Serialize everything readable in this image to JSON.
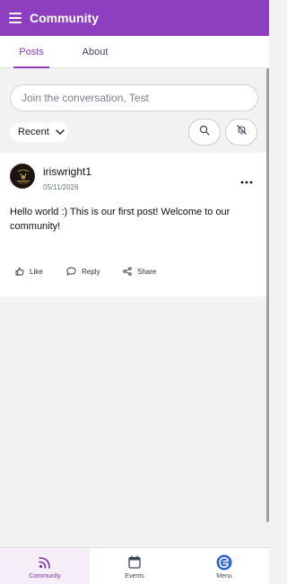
{
  "header": {
    "title": "Community"
  },
  "tabs": [
    {
      "label": "Posts",
      "active": true
    },
    {
      "label": "About",
      "active": false
    }
  ],
  "compose": {
    "placeholder": "Join the conversation, Test"
  },
  "sort": {
    "selected": "Recent"
  },
  "post": {
    "author": "iriswright1",
    "date": "05/11/2026",
    "body": "Hello world :) This is our first post! Welcome to our community!",
    "actions": {
      "like": "Like",
      "reply": "Reply",
      "share": "Share"
    }
  },
  "bottom_nav": [
    {
      "label": "Community",
      "icon": "rss-icon",
      "active": true
    },
    {
      "label": "Events",
      "icon": "calendar-icon",
      "active": false
    },
    {
      "label": "Menu",
      "icon": "menu-logo-icon",
      "active": false
    }
  ],
  "colors": {
    "brand": "#8d3fbf",
    "nav_active_bg": "#f6eef9",
    "menu_logo": "#2a63c8"
  }
}
